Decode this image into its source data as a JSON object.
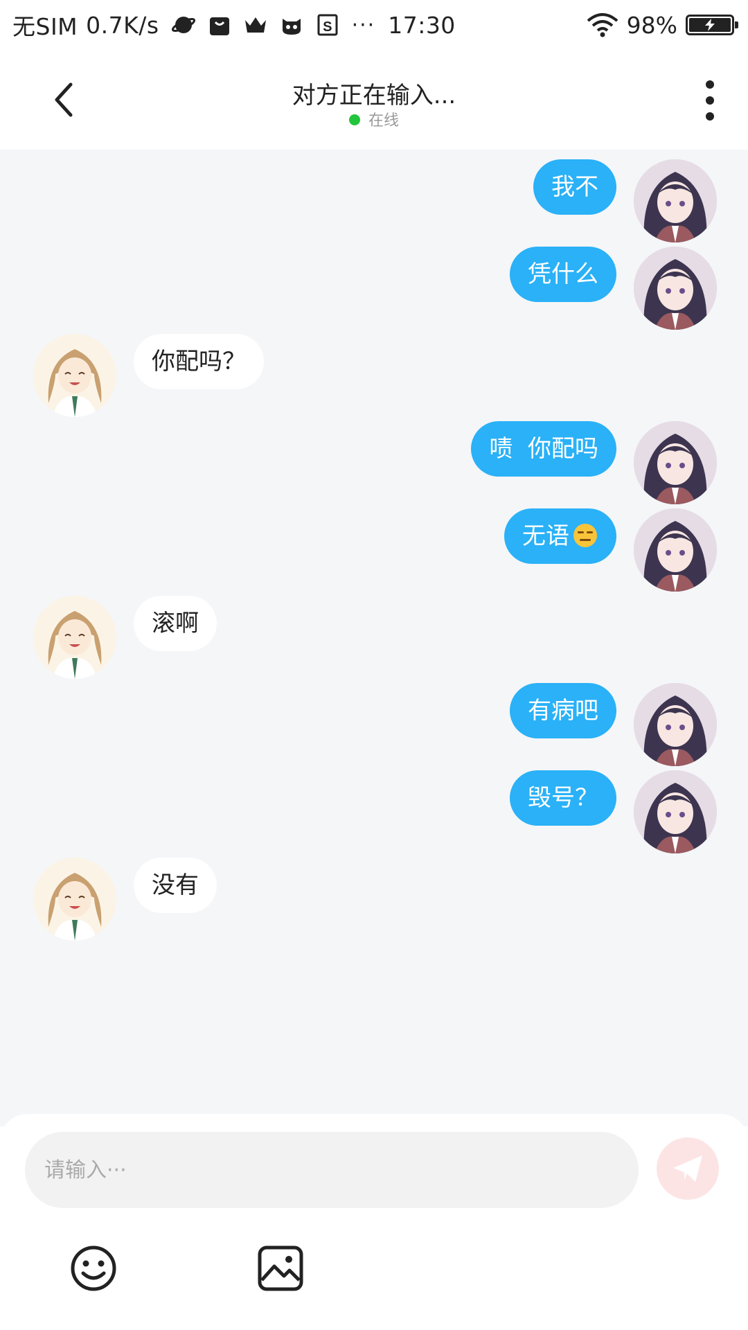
{
  "status_bar": {
    "sim": "无SIM",
    "speed": "0.7K/s",
    "more": "···",
    "time": "17:30",
    "battery": "98%"
  },
  "header": {
    "title": "对方正在输入...",
    "status": "在线",
    "status_color": "#22c53c"
  },
  "colors": {
    "my_bubble": "#2ab1f7",
    "other_bubble": "#ffffff",
    "chat_background": "#f4f6f8",
    "send_button": "#fde4e4"
  },
  "messages": [
    {
      "from": "me",
      "text": "我不"
    },
    {
      "from": "me",
      "text": "凭什么"
    },
    {
      "from": "other",
      "text": "你配吗？"
    },
    {
      "from": "me",
      "text": "啧  你配吗"
    },
    {
      "from": "me",
      "text": "无语",
      "emoji": "expressionless-face"
    },
    {
      "from": "other",
      "text": "滚啊"
    },
    {
      "from": "me",
      "text": "有病吧"
    },
    {
      "from": "me",
      "text": "毁号？"
    },
    {
      "from": "other",
      "text": "没有"
    }
  ],
  "composer": {
    "placeholder": "请输入···",
    "send_icon": "paper-plane-icon",
    "tools": [
      "smiley-icon",
      "image-icon"
    ]
  }
}
